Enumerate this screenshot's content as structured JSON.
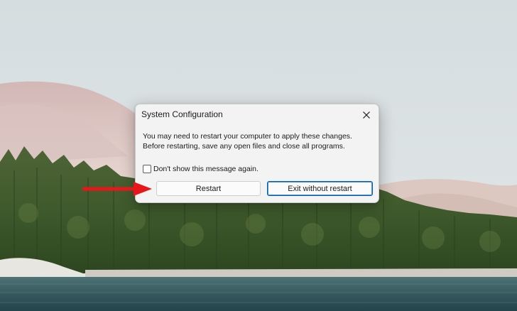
{
  "dialog": {
    "title": "System Configuration",
    "message_line1": "You may need to restart your computer to apply these changes.",
    "message_line2": "Before restarting, save any open files and close all programs.",
    "checkbox_label": "Don't show this message again.",
    "checkbox_checked": false,
    "restart_label": "Restart",
    "exit_label": "Exit without restart"
  },
  "icons": {
    "close": "close-icon",
    "annotation_arrow": "arrow-right-icon"
  },
  "colors": {
    "annotation_arrow": "#e8161b",
    "default_button_border": "#005fb8",
    "dialog_background": "#f3f3f3"
  }
}
